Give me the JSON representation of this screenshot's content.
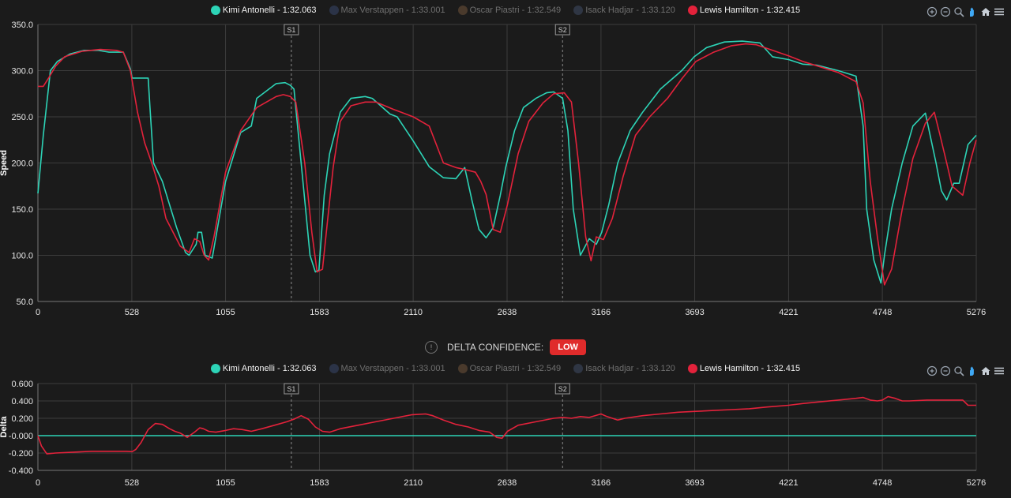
{
  "legend": [
    {
      "label": "Kimi Antonelli - 1:32.063",
      "color": "#2dd4b7",
      "active": true
    },
    {
      "label": "Max Verstappen - 1:33.001",
      "color": "#2b3347",
      "active": false
    },
    {
      "label": "Oscar Piastri - 1:32.549",
      "color": "#4a3a2c",
      "active": false
    },
    {
      "label": "Isack Hadjar - 1:33.120",
      "color": "#2f3644",
      "active": false
    },
    {
      "label": "Lewis Hamilton - 1:32.415",
      "color": "#e3223b",
      "active": true
    }
  ],
  "toolbar": [
    "zoom-in-icon",
    "zoom-out-icon",
    "magnify-icon",
    "pan-hand-icon",
    "home-icon",
    "menu-icon"
  ],
  "confidence": {
    "label": "DELTA CONFIDENCE:",
    "value": "LOW",
    "icon": "!"
  },
  "colors": {
    "background": "#1b1b1b",
    "grid": "#3c3c3c",
    "antonelli": "#2dd4b7",
    "hamilton": "#e3223b",
    "badge": "#e02b2b"
  },
  "chart_data": [
    {
      "type": "line",
      "ylabel": "Speed",
      "xlim": [
        0,
        5276
      ],
      "ylim": [
        50,
        350
      ],
      "x_ticks": [
        "0",
        "528",
        "1055",
        "1583",
        "2110",
        "2638",
        "3166",
        "3693",
        "4221",
        "4748",
        "5276"
      ],
      "y_ticks": [
        "50.0",
        "100.0",
        "150.0",
        "200.0",
        "250.0",
        "300.0",
        "350.0"
      ],
      "sectors": [
        {
          "label": "S1",
          "x": 1425
        },
        {
          "label": "S2",
          "x": 2950
        }
      ],
      "series": [
        {
          "name": "Kimi Antonelli - 1:32.063",
          "color": "#2dd4b7",
          "x": [
            0,
            30,
            70,
            110,
            180,
            260,
            340,
            400,
            480,
            520,
            530,
            620,
            630,
            650,
            700,
            780,
            830,
            850,
            890,
            900,
            920,
            940,
            980,
            1055,
            1140,
            1200,
            1230,
            1340,
            1390,
            1420,
            1440,
            1500,
            1530,
            1560,
            1580,
            1610,
            1640,
            1700,
            1760,
            1840,
            1880,
            1980,
            2020,
            2110,
            2200,
            2280,
            2350,
            2400,
            2440,
            2480,
            2520,
            2560,
            2600,
            2630,
            2680,
            2730,
            2800,
            2860,
            2900,
            2950,
            2980,
            3010,
            3050,
            3100,
            3140,
            3170,
            3210,
            3260,
            3330,
            3400,
            3500,
            3620,
            3690,
            3760,
            3860,
            3960,
            4060,
            4130,
            4221,
            4300,
            4380,
            4500,
            4600,
            4640,
            4660,
            4700,
            4740,
            4760,
            4800,
            4860,
            4920,
            4990,
            5050,
            5080,
            5110,
            5150,
            5180,
            5230,
            5276
          ],
          "y": [
            167,
            230,
            300,
            310,
            318,
            322,
            322,
            320,
            320,
            302,
            292,
            292,
            260,
            200,
            180,
            130,
            103,
            100,
            112,
            125,
            125,
            100,
            97,
            180,
            233,
            240,
            270,
            286,
            287,
            284,
            280,
            160,
            100,
            82,
            84,
            165,
            210,
            255,
            270,
            272,
            270,
            253,
            250,
            224,
            196,
            184,
            183,
            195,
            160,
            128,
            119,
            130,
            165,
            195,
            235,
            260,
            270,
            276,
            277,
            270,
            235,
            150,
            100,
            118,
            112,
            125,
            155,
            200,
            235,
            255,
            280,
            300,
            315,
            325,
            331,
            332,
            330,
            315,
            312,
            307,
            306,
            300,
            294,
            240,
            150,
            95,
            70,
            100,
            150,
            200,
            240,
            254,
            200,
            170,
            160,
            178,
            178,
            220,
            230
          ]
        },
        {
          "name": "Lewis Hamilton - 1:32.415",
          "color": "#e3223b",
          "x": [
            0,
            30,
            60,
            100,
            150,
            250,
            350,
            440,
            480,
            520,
            560,
            600,
            640,
            680,
            720,
            800,
            850,
            880,
            910,
            935,
            960,
            990,
            1055,
            1140,
            1230,
            1340,
            1380,
            1420,
            1450,
            1500,
            1540,
            1570,
            1600,
            1630,
            1660,
            1700,
            1760,
            1840,
            1900,
            2000,
            2110,
            2200,
            2280,
            2350,
            2400,
            2460,
            2490,
            2520,
            2560,
            2600,
            2640,
            2700,
            2760,
            2840,
            2900,
            2960,
            3000,
            3040,
            3080,
            3110,
            3140,
            3180,
            3230,
            3290,
            3360,
            3440,
            3540,
            3620,
            3700,
            3800,
            3900,
            3980,
            4040,
            4100,
            4221,
            4300,
            4400,
            4500,
            4600,
            4640,
            4680,
            4720,
            4760,
            4800,
            4860,
            4920,
            4990,
            5040,
            5070,
            5110,
            5140,
            5200,
            5240,
            5276
          ],
          "y": [
            283,
            283,
            292,
            305,
            315,
            321,
            323,
            322,
            320,
            300,
            255,
            222,
            200,
            175,
            140,
            110,
            103,
            118,
            115,
            100,
            95,
            120,
            190,
            235,
            260,
            272,
            274,
            272,
            266,
            200,
            125,
            82,
            85,
            140,
            195,
            245,
            262,
            266,
            266,
            258,
            250,
            240,
            200,
            195,
            193,
            190,
            180,
            166,
            128,
            125,
            155,
            210,
            245,
            265,
            275,
            276,
            266,
            200,
            120,
            94,
            120,
            117,
            140,
            185,
            230,
            250,
            270,
            291,
            310,
            320,
            327,
            329,
            328,
            324,
            316,
            310,
            304,
            298,
            288,
            265,
            180,
            120,
            68,
            85,
            150,
            205,
            243,
            255,
            232,
            200,
            175,
            165,
            200,
            225
          ]
        }
      ]
    },
    {
      "type": "line",
      "ylabel": "Delta",
      "xlim": [
        0,
        5276
      ],
      "ylim": [
        -0.4,
        0.6
      ],
      "x_ticks": [
        "0",
        "528",
        "1055",
        "1583",
        "2110",
        "2638",
        "3166",
        "3693",
        "4221",
        "4748",
        "5276"
      ],
      "y_ticks": [
        "-0.400",
        "-0.200",
        "-0.000",
        "0.200",
        "0.400",
        "0.600"
      ],
      "sectors": [
        {
          "label": "S1",
          "x": 1425
        },
        {
          "label": "S2",
          "x": 2950
        }
      ],
      "series": [
        {
          "name": "Kimi Antonelli - 1:32.063",
          "color": "#2dd4b7",
          "x": [
            0,
            5276
          ],
          "y": [
            0,
            0
          ]
        },
        {
          "name": "Lewis Hamilton - 1:32.415",
          "color": "#e3223b",
          "x": [
            0,
            20,
            50,
            100,
            200,
            300,
            400,
            500,
            530,
            550,
            580,
            620,
            660,
            700,
            740,
            770,
            800,
            840,
            880,
            910,
            930,
            960,
            1000,
            1055,
            1100,
            1150,
            1200,
            1260,
            1330,
            1400,
            1440,
            1480,
            1520,
            1560,
            1600,
            1640,
            1700,
            1800,
            1900,
            2000,
            2100,
            2180,
            2220,
            2280,
            2350,
            2420,
            2480,
            2540,
            2580,
            2610,
            2640,
            2700,
            2800,
            2900,
            2950,
            3000,
            3050,
            3100,
            3166,
            3200,
            3260,
            3300,
            3400,
            3500,
            3600,
            3700,
            3800,
            3900,
            4000,
            4100,
            4221,
            4300,
            4400,
            4500,
            4600,
            4640,
            4680,
            4720,
            4748,
            4780,
            4820,
            4860,
            4900,
            5000,
            5100,
            5200,
            5230,
            5276
          ],
          "y": [
            0.0,
            -0.12,
            -0.21,
            -0.2,
            -0.19,
            -0.18,
            -0.18,
            -0.18,
            -0.185,
            -0.16,
            -0.08,
            0.07,
            0.14,
            0.13,
            0.08,
            0.05,
            0.03,
            -0.02,
            0.04,
            0.09,
            0.08,
            0.05,
            0.04,
            0.06,
            0.08,
            0.07,
            0.05,
            0.08,
            0.12,
            0.16,
            0.19,
            0.23,
            0.19,
            0.1,
            0.05,
            0.04,
            0.08,
            0.12,
            0.16,
            0.2,
            0.24,
            0.25,
            0.23,
            0.18,
            0.13,
            0.1,
            0.06,
            0.04,
            -0.02,
            -0.03,
            0.05,
            0.12,
            0.16,
            0.2,
            0.21,
            0.2,
            0.22,
            0.21,
            0.25,
            0.22,
            0.18,
            0.2,
            0.23,
            0.25,
            0.27,
            0.28,
            0.29,
            0.3,
            0.31,
            0.33,
            0.35,
            0.37,
            0.39,
            0.41,
            0.43,
            0.44,
            0.41,
            0.4,
            0.41,
            0.45,
            0.43,
            0.4,
            0.4,
            0.41,
            0.41,
            0.41,
            0.35,
            0.35
          ]
        }
      ]
    }
  ]
}
